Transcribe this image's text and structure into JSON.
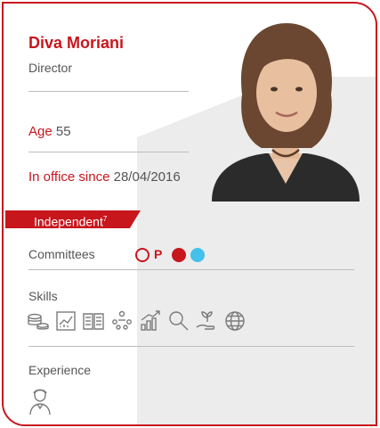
{
  "profile": {
    "name": "Diva Moriani",
    "role": "Director",
    "age_label": "Age",
    "age_value": "55",
    "office_label": "In office since",
    "office_value": "28/04/2016",
    "badge_label": "Independent",
    "badge_note": "7"
  },
  "committees": {
    "label": "Committees",
    "p_mark": "P",
    "colors": {
      "outline": "#c8161d",
      "red": "#c8161d",
      "blue": "#43c1ea"
    }
  },
  "skills": {
    "label": "Skills",
    "icons": [
      "coins-stack-icon",
      "chart-document-icon",
      "open-book-icon",
      "team-meeting-icon",
      "growth-chart-icon",
      "magnifier-icon",
      "hand-plant-icon",
      "globe-icon"
    ]
  },
  "experience": {
    "label": "Experience",
    "icons": [
      "person-portrait-icon"
    ]
  },
  "colors": {
    "accent": "#c8161d",
    "text": "#555555",
    "icon_stroke": "#7a7a7a"
  }
}
